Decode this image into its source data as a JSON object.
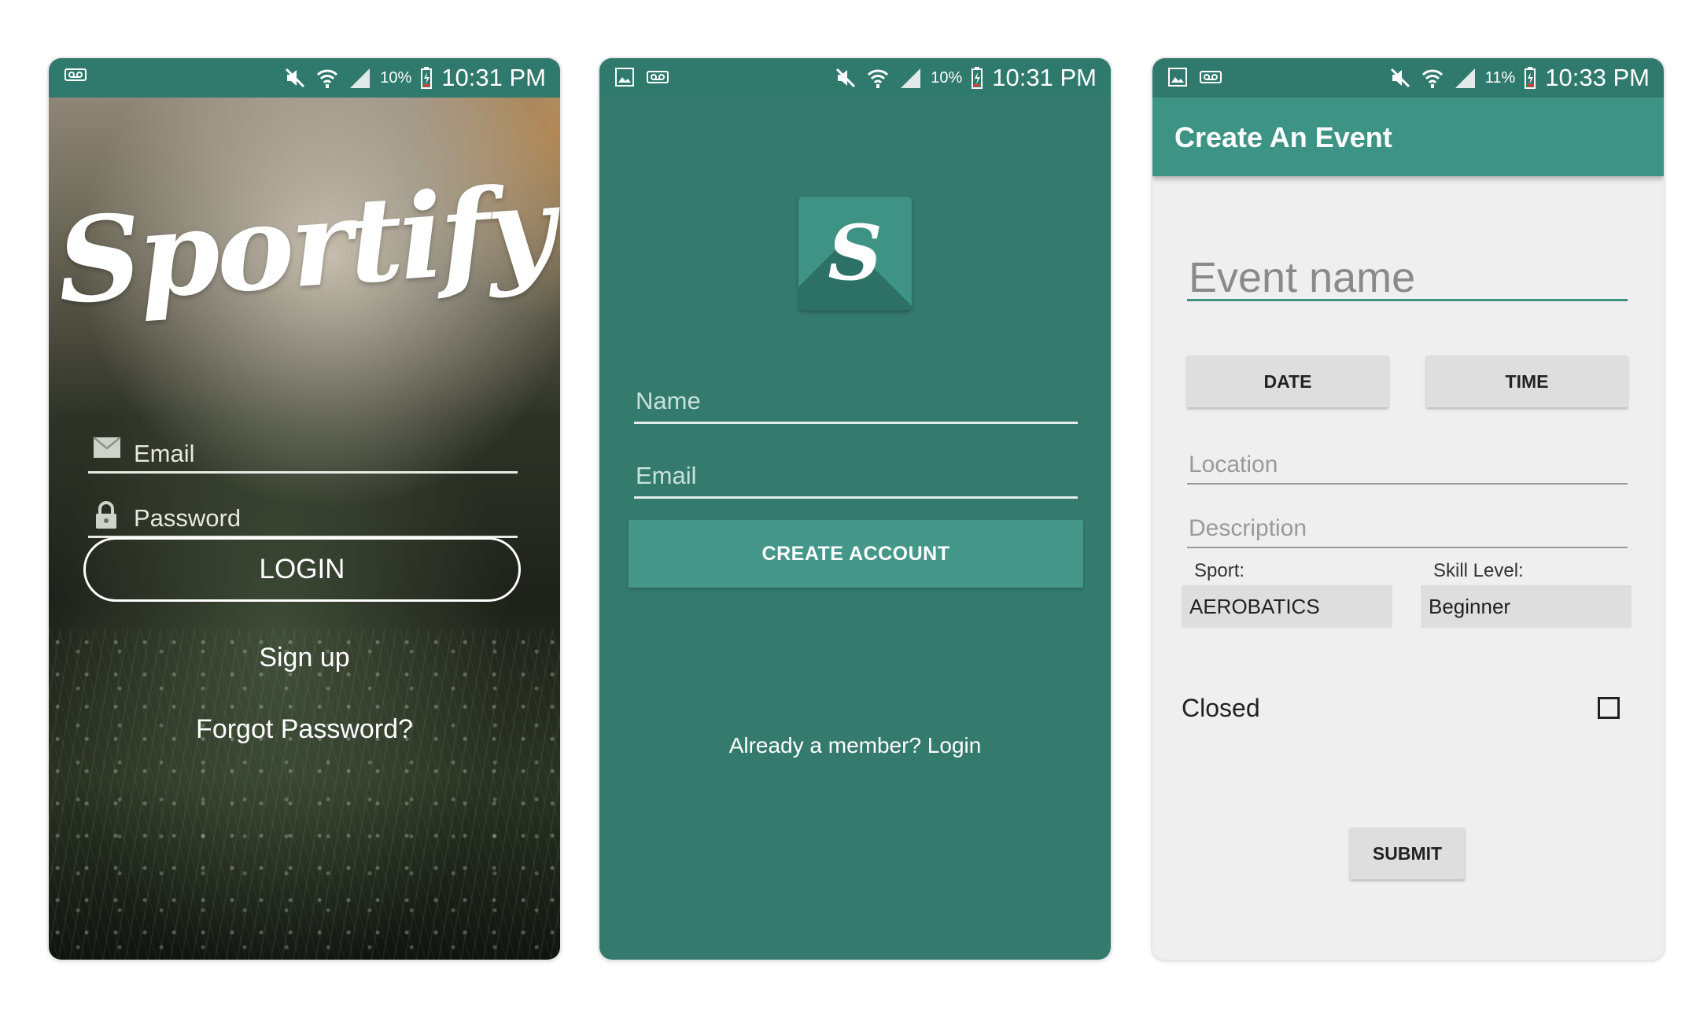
{
  "status_bars": [
    {
      "battery": "10%",
      "time": "10:31 PM"
    },
    {
      "battery": "10%",
      "time": "10:31 PM"
    },
    {
      "battery": "11%",
      "time": "10:33 PM"
    }
  ],
  "login_screen": {
    "logo_text": "Sportify",
    "email_placeholder": "Email",
    "password_placeholder": "Password",
    "login_label": "LOGIN",
    "signup_label": "Sign up",
    "forgot_label": "Forgot Password?"
  },
  "signup_screen": {
    "logo_letter": "S",
    "name_placeholder": "Name",
    "email_placeholder": "Email",
    "create_label": "CREATE ACCOUNT",
    "login_link": "Already a member? Login"
  },
  "event_screen": {
    "title": "Create An Event",
    "event_name_placeholder": "Event name",
    "date_label": "DATE",
    "time_label": "TIME",
    "location_placeholder": "Location",
    "description_placeholder": "Description",
    "sport_label": "Sport:",
    "sport_value": "AEROBATICS",
    "skill_label": "Skill Level:",
    "skill_value": "Beginner",
    "closed_label": "Closed",
    "closed_checked": false,
    "submit_label": "SUBMIT"
  },
  "colors": {
    "teal_dark": "#2f7a6d",
    "teal": "#347a6d",
    "teal_button": "#45978a",
    "app_bar": "#3d9384"
  },
  "icons": [
    "voicemail-icon",
    "gallery-icon",
    "mute-icon",
    "wifi-icon",
    "signal-icon",
    "battery-icon",
    "mail-icon",
    "lock-icon"
  ]
}
